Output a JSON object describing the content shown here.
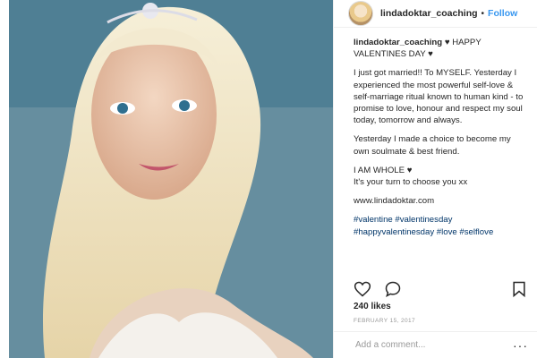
{
  "photo": {
    "alt": "Selfie of a woman with long blonde hair and a jeweled headpiece"
  },
  "header": {
    "username": "lindadoktar_coaching",
    "separator": "•",
    "follow_label": "Follow"
  },
  "caption": {
    "username": "lindadoktar_coaching",
    "lines": [
      "♥ HAPPY VALENTINES DAY ♥",
      "I just got married!! To MYSELF. Yesterday I experienced the most powerful self-love & self-marriage ritual known to human kind - to promise to love, honour and respect my soul today, tomorrow and always.",
      "Yesterday I made a choice to become my own soulmate & best friend.",
      "I AM WHOLE ♥",
      "It's your turn to choose you xx",
      "www.lindadoktar.com",
      "#valentine #valentinesday #happyvalentinesday #love #selflove"
    ]
  },
  "actions": {
    "like_icon": "heart-icon",
    "comment_icon": "comment-icon",
    "save_icon": "bookmark-icon"
  },
  "likes_text": "240 likes",
  "date_text": "FEBRUARY 15, 2017",
  "comment": {
    "placeholder": "Add a comment...",
    "more_label": "···"
  },
  "colors": {
    "link": "#3897f0",
    "hashtag": "#003569",
    "border": "#efefef"
  }
}
